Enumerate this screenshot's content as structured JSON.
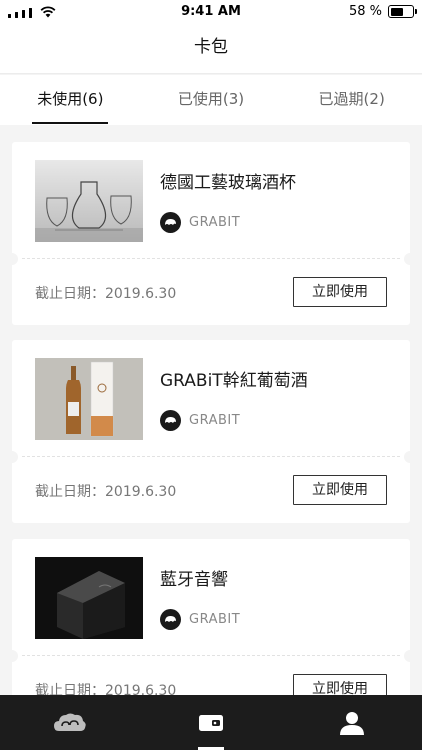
{
  "status_bar": {
    "time": "9:41 AM",
    "battery_text": "58 %",
    "battery_level": 0.58
  },
  "header": {
    "title": "卡包"
  },
  "tabs": [
    {
      "label": "未使用(6)",
      "active": true
    },
    {
      "label": "已使用(3)",
      "active": false
    },
    {
      "label": "已過期(2)",
      "active": false
    }
  ],
  "cards": [
    {
      "title": "德國工藝玻璃酒杯",
      "brand": "GRABIT",
      "expiry": "截止日期：2019.6.30",
      "action": "立即使用",
      "image": "glass-decanter-photo"
    },
    {
      "title": "GRABiT幹紅葡萄酒",
      "brand": "GRABIT",
      "expiry": "截止日期：2019.6.30",
      "action": "立即使用",
      "image": "wine-bottle-photo"
    },
    {
      "title": "藍牙音響",
      "brand": "GRABIT",
      "expiry": "截止日期：2019.6.30",
      "action": "立即使用",
      "image": "bluetooth-speaker-photo"
    }
  ],
  "bottom_nav": [
    {
      "icon": "cloud-icon",
      "active": false
    },
    {
      "icon": "wallet-icon",
      "active": true
    },
    {
      "icon": "user-icon",
      "active": false
    }
  ]
}
